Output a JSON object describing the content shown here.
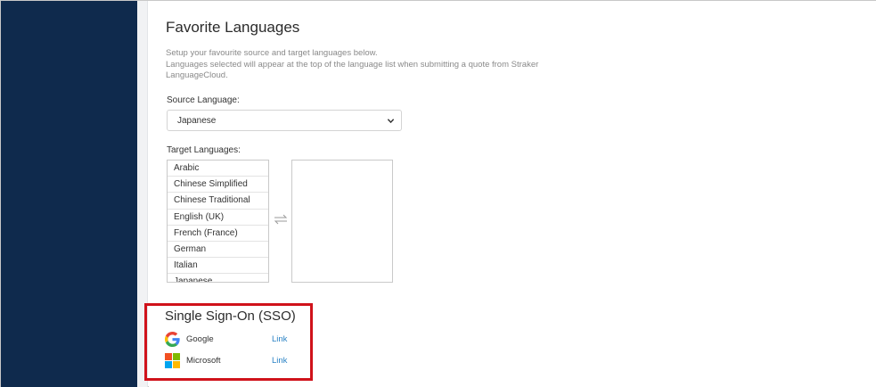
{
  "favorites": {
    "title": "Favorite Languages",
    "description_lines": [
      "Setup your favourite source and target languages below.",
      "Languages selected will appear at the top of the language list when submitting a quote from Straker",
      "LanguageCloud."
    ],
    "source_label": "Source Language:",
    "source_value": "Japanese",
    "target_label": "Target Languages:",
    "target_options": [
      "Arabic",
      "Chinese Simplified",
      "Chinese Traditional",
      "English (UK)",
      "French (France)",
      "German",
      "Italian",
      "Japanese"
    ],
    "swap_icon": "swap-arrows-icon"
  },
  "sso": {
    "title": "Single Sign-On (SSO)",
    "providers": [
      {
        "name": "Google",
        "link": "Link",
        "icon": "google-logo-icon"
      },
      {
        "name": "Microsoft",
        "link": "Link",
        "icon": "microsoft-logo-icon"
      }
    ],
    "highlight_color": "#d0121b"
  },
  "colors": {
    "sidebar": "#0f2a4d",
    "link": "#2b83c5"
  }
}
